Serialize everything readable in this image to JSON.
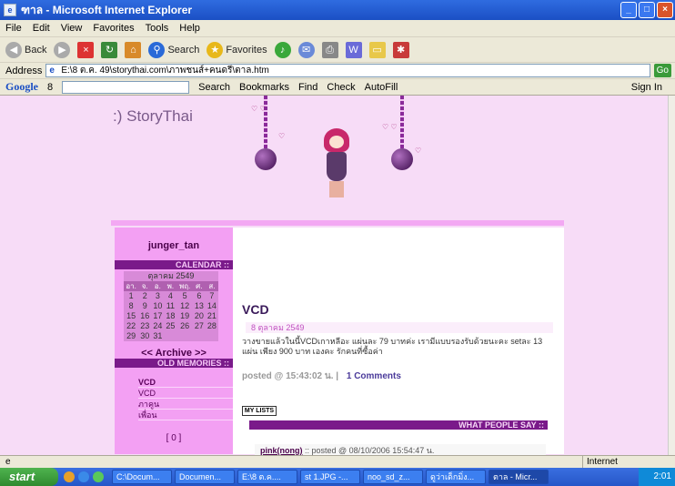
{
  "window": {
    "title": "ฑาล - Microsoft Internet Explorer"
  },
  "menu": [
    "File",
    "Edit",
    "View",
    "Favorites",
    "Tools",
    "Help"
  ],
  "toolbar": {
    "back": "Back",
    "search": "Search",
    "favorites": "Favorites"
  },
  "address": {
    "label": "Address",
    "url": "E:\\8 ต.ค. 49\\storythai.com\\ภาพชนส์+คนดรี\\ตาล.htm",
    "go": "Go"
  },
  "google": {
    "logo": "Google",
    "g": "8",
    "search": "Search",
    "bookmarks": "Bookmarks",
    "find": "Find",
    "check": "Check",
    "autofill": "AutoFill",
    "signin": "Sign In"
  },
  "site": {
    "title": ":) StoryThai"
  },
  "sidebar": {
    "user": "junger_tan",
    "calendar_head": "CALENDAR ::",
    "month": "ตุลาคม 2549",
    "days": [
      "อา.",
      "จ.",
      "อ.",
      "พ.",
      "พฤ.",
      "ศ.",
      "ส."
    ],
    "weeks": [
      [
        "1",
        "2",
        "3",
        "4",
        "5",
        "6",
        "7"
      ],
      [
        "8",
        "9",
        "10",
        "11",
        "12",
        "13",
        "14"
      ],
      [
        "15",
        "16",
        "17",
        "18",
        "19",
        "20",
        "21"
      ],
      [
        "22",
        "23",
        "24",
        "25",
        "26",
        "27",
        "28"
      ],
      [
        "29",
        "30",
        "31",
        "",
        "",
        "",
        ""
      ]
    ],
    "archive": "<< Archive >>",
    "memories_head": "OLD MEMORIES ::",
    "memories": [
      "VCD",
      "VCD",
      "ภาคูน",
      "เพื่อน"
    ],
    "count": "[ 0 ]"
  },
  "post": {
    "title": "VCD",
    "date": "8 ตุลาคม 2549",
    "body": "วางขายแล้วในนี้VCDเกาหลีอะ แผ่นละ 79 บาทค่ะ เรามีแบบรองรับด้วยนะคะ setละ 13 แผ่น เพียง 900 บาท เองคะ รักคนที่ซื้อค่า",
    "posted": "posted @ 15:43:02 น. |",
    "comments": "1 Comments",
    "mylists": "MY LISTS",
    "people_head": "WHAT PEOPLE SAY ::",
    "comment_author": "pink(nong)",
    "comment_meta": ":: posted @ 08/10/2006 15:54:47 น."
  },
  "status": {
    "zone": "Internet"
  },
  "taskbar": {
    "start": "start",
    "tasks": [
      "C:\\Docum...",
      "Documen...",
      "E:\\8 ต.ค....",
      "st 1.JPG -...",
      "noo_sd_z...",
      "ดูว่าเด็กมิ่ง...",
      "ตาล - Micr..."
    ],
    "clock": "2:01"
  },
  "colors": {
    "page_bg": "#f7dcf7",
    "sidebar": "#f3a0f3",
    "header_bar": "#7a1a8a"
  }
}
